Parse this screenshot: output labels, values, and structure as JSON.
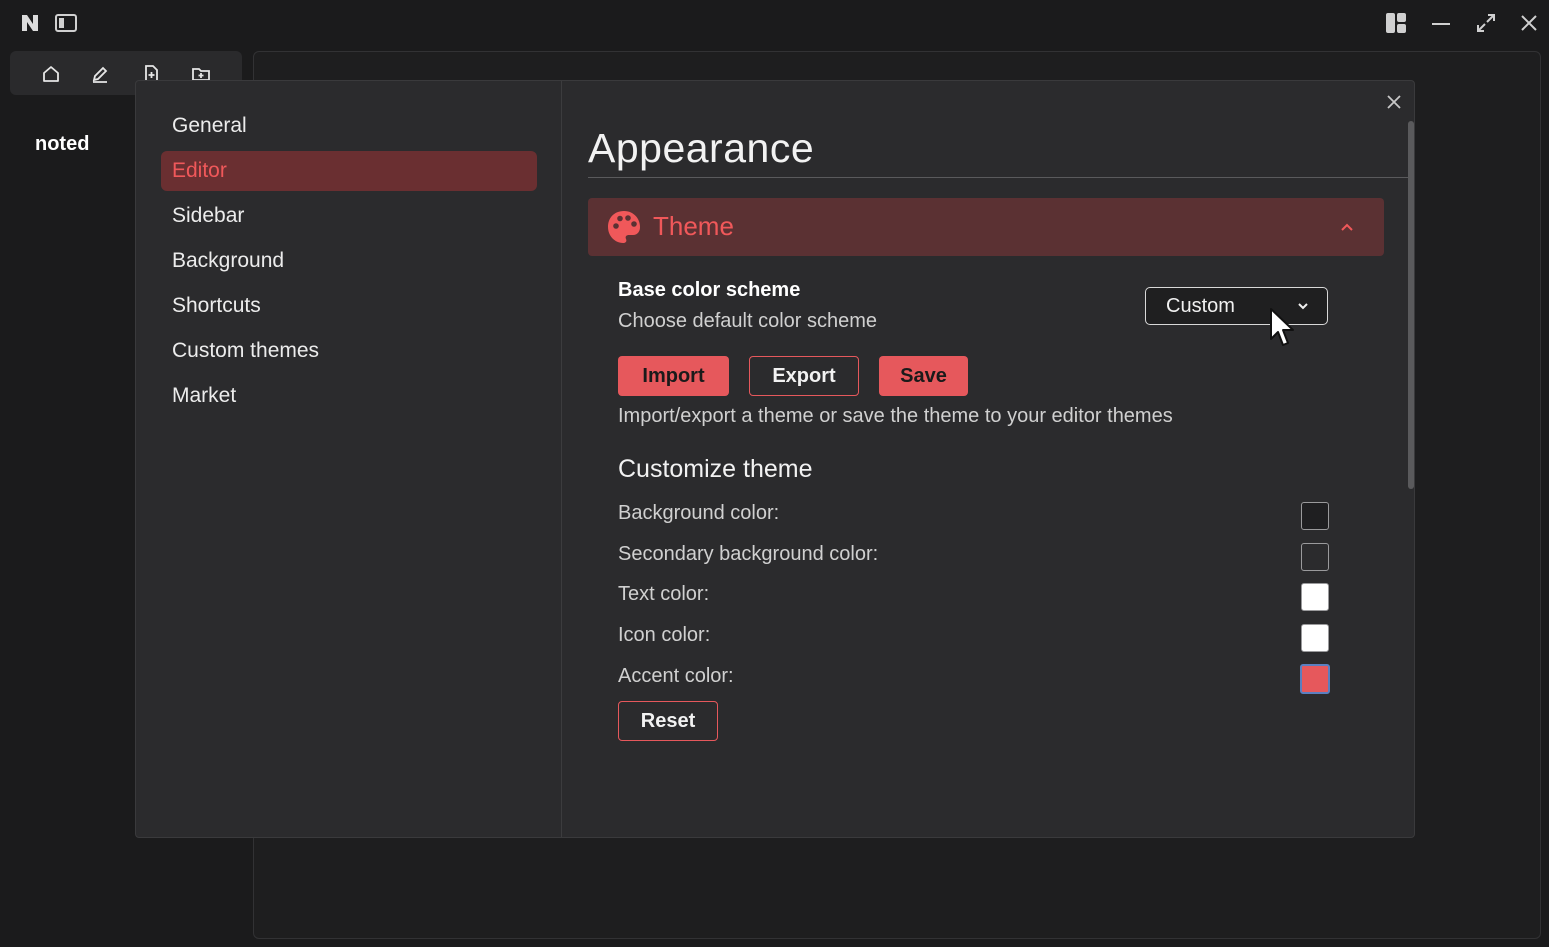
{
  "app": {
    "brand": "noted"
  },
  "settings": {
    "nav": [
      {
        "label": "General",
        "active": false
      },
      {
        "label": "Editor",
        "active": true
      },
      {
        "label": "Sidebar",
        "active": false
      },
      {
        "label": "Background",
        "active": false
      },
      {
        "label": "Shortcuts",
        "active": false
      },
      {
        "label": "Custom themes",
        "active": false
      },
      {
        "label": "Market",
        "active": false
      }
    ],
    "title": "Appearance",
    "section": "Theme",
    "base_scheme": {
      "title": "Base color scheme",
      "description": "Choose default color scheme",
      "selected": "Custom"
    },
    "buttons": {
      "import": "Import",
      "export": "Export",
      "save": "Save",
      "reset": "Reset"
    },
    "import_export_desc": "Import/export a theme or save the theme to your editor themes",
    "customize_heading": "Customize theme",
    "colors": [
      {
        "label": "Background color:",
        "value": "#1f1f21"
      },
      {
        "label": "Secondary background color:",
        "value": "#2b2b2d"
      },
      {
        "label": "Text color:",
        "value": "#ffffff"
      },
      {
        "label": "Icon color:",
        "value": "#ffffff"
      },
      {
        "label": "Accent color:",
        "value": "#e6585c"
      }
    ]
  },
  "icons": {
    "titlebar_left": [
      "app-logo-icon",
      "sidebar-toggle-icon"
    ],
    "titlebar_right": [
      "layout-icon",
      "minimize-icon",
      "maximize-icon",
      "close-icon"
    ],
    "toolbar": [
      "home-icon",
      "edit-icon",
      "new-file-icon",
      "new-folder-icon"
    ]
  },
  "theme_colors": {
    "accent": "#e6585c",
    "accent_text": "#f0585a",
    "active_nav_bg": "#6a2f31",
    "theme_bar_bg": "#5b3133"
  }
}
